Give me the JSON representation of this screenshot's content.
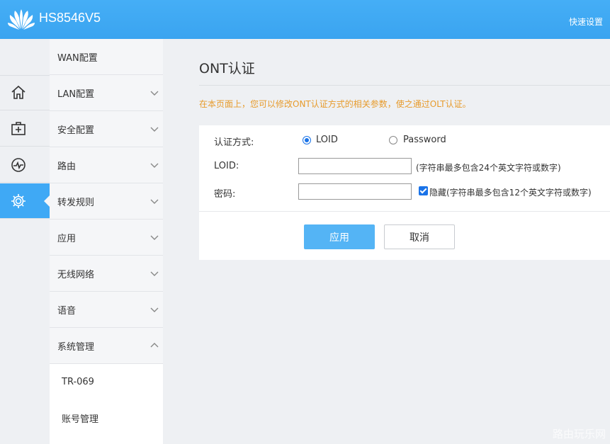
{
  "header": {
    "model": "HS8546V5",
    "quick_setup": "快速设置"
  },
  "rail": {
    "icons": [
      "home-icon",
      "first-aid-icon",
      "monitor-icon",
      "gear-icon"
    ],
    "active_index": 3
  },
  "menu": {
    "items": [
      {
        "label": "WAN配置",
        "chevron": "none"
      },
      {
        "label": "LAN配置",
        "chevron": "down"
      },
      {
        "label": "安全配置",
        "chevron": "down"
      },
      {
        "label": "路由",
        "chevron": "down"
      },
      {
        "label": "转发规则",
        "chevron": "down"
      },
      {
        "label": "应用",
        "chevron": "down"
      },
      {
        "label": "无线网络",
        "chevron": "down"
      },
      {
        "label": "语音",
        "chevron": "down"
      },
      {
        "label": "系统管理",
        "chevron": "up"
      }
    ],
    "subitems": [
      {
        "label": "TR-069"
      },
      {
        "label": "账号管理"
      }
    ]
  },
  "content": {
    "title": "ONT认证",
    "description": "在本页面上，您可以修改ONT认证方式的相关参数，使之通过OLT认证。",
    "form": {
      "auth_mode_label": "认证方式:",
      "option_loid": "LOID",
      "option_password": "Password",
      "selected_option": "LOID",
      "loid_label": "LOID:",
      "loid_value": "",
      "loid_hint": "(字符串最多包含24个英文字符或数字)",
      "password_label": "密码:",
      "password_value": "",
      "hide_checked": true,
      "hide_hint": "隐藏(字符串最多包含12个英文字符或数字)"
    },
    "buttons": {
      "apply": "应用",
      "cancel": "取消"
    }
  },
  "colors": {
    "header": "#3fa9f5",
    "accent": "#1a73e8",
    "description": "#e79b2c"
  },
  "watermark": "路由玩乐网"
}
